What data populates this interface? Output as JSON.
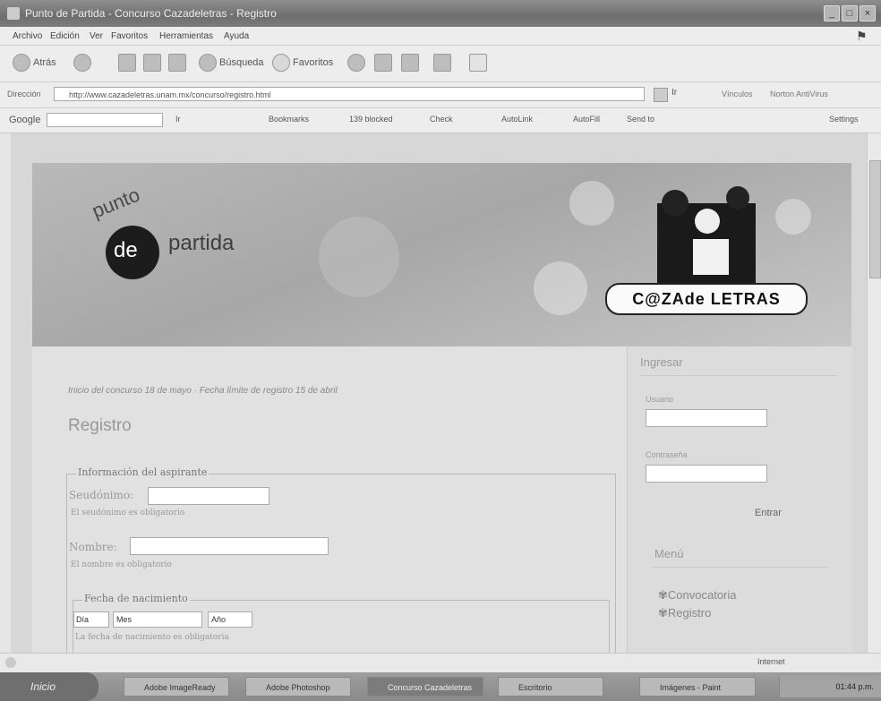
{
  "window": {
    "title": "Punto de Partida - Concurso Cazadeletras - Registro"
  },
  "menubar": {
    "items": [
      "Archivo",
      "Edición",
      "Ver",
      "Favoritos",
      "Herramientas",
      "Ayuda"
    ]
  },
  "toolbar": {
    "back_label": "Atrás",
    "search_label": "Búsqueda",
    "favorites_label": "Favoritos"
  },
  "addressbar": {
    "label": "Dirección",
    "url": "http://www.cazadeletras.unam.mx/concurso/registro.html",
    "go_label": "Ir",
    "links_label": "Vínculos",
    "links_extra": "Norton AntiVirus"
  },
  "googlebar": {
    "label": "Google",
    "items": [
      "Ir",
      "Bookmarks",
      "139 blocked",
      "Check",
      "AutoLink",
      "AutoFill",
      "Send to"
    ],
    "settings_label": "Settings"
  },
  "banner": {
    "logo_punto": "punto",
    "logo_de": "de",
    "logo_partida": "partida",
    "cazade_text": "C@ZAde LETRAS"
  },
  "content": {
    "notice": "Inicio del concurso 18 de mayo · Fecha límite de registro 15 de abril",
    "heading": "Registro",
    "fieldset_legend": "Información del aspirante",
    "seudonimo_label": "Seudónimo:",
    "seudonimo_hint": "El seudónimo es obligatorio",
    "nombre_label": "Nombre:",
    "nombre_hint": "El nombre es obligatorio",
    "fecha_legend": "Fecha de nacimiento",
    "dia_value": "Día",
    "mes_value": "Mes",
    "anio_value": "Año",
    "fecha_hint": "La fecha de nacimiento es obligatoria"
  },
  "sidebar": {
    "ingresar_title": "Ingresar",
    "user_label": "Usuario",
    "password_label": "Contraseña",
    "entrar_label": "Entrar",
    "menu_title": "Menú",
    "menu_items": [
      "Convocatoria",
      "Registro"
    ]
  },
  "statusbar": {
    "zone_label": "Internet"
  },
  "taskbar": {
    "start_label": "Inicio",
    "tasks": [
      "Adobe ImageReady",
      "Adobe Photoshop",
      "Concurso Cazadeletras",
      "Escritorio",
      "Imágenes - Paint"
    ],
    "clock": "01:44 p.m."
  }
}
